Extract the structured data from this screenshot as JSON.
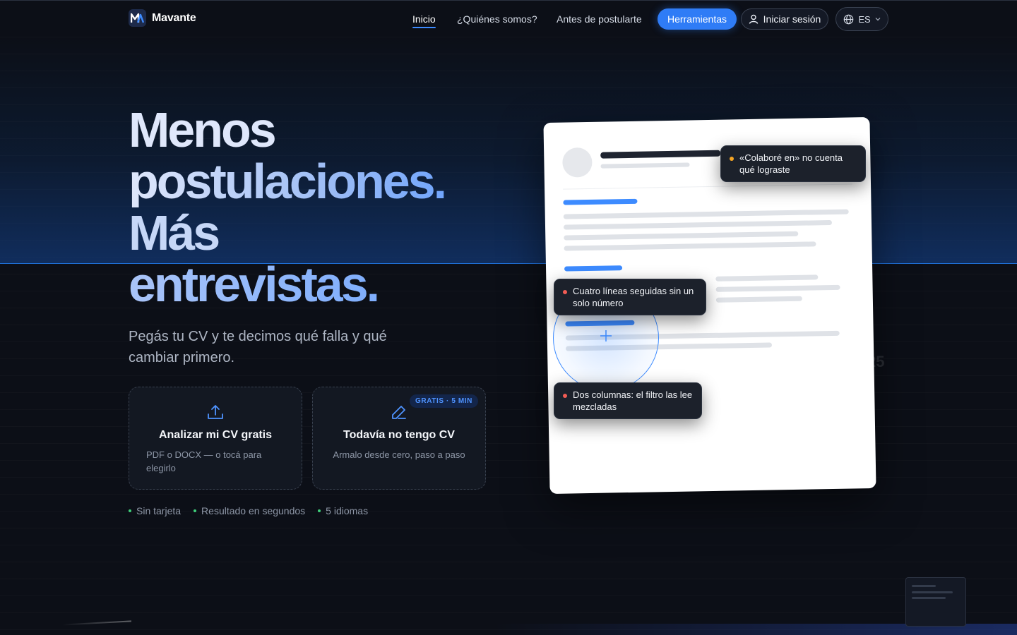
{
  "brand": {
    "name": "Mavante",
    "logo_text": "M"
  },
  "nav": {
    "links": [
      "Inicio",
      "¿Quiénes somos?",
      "Antes de postularte"
    ],
    "tools_button": "Herramientas",
    "login_button": "Iniciar sesión",
    "language": "ES"
  },
  "hero": {
    "title_lines": [
      "Menos",
      "postulaciones.",
      "Más",
      "entrevistas."
    ],
    "subtitle": "Pegás tu CV y te decimos qué falla y qué cambiar primero."
  },
  "actions": {
    "analyze": {
      "title": "Analizar mi CV gratis",
      "desc": "PDF o DOCX — o tocá para elegirlo",
      "icon": "upload-icon"
    },
    "create": {
      "title": "Todavía no tengo CV",
      "desc": "Armalo desde cero, paso a paso",
      "badge": "GRATIS · 5 MIN",
      "icon": "pencil-icon"
    }
  },
  "perks": [
    "Sin tarjeta",
    "Resultado en segundos",
    "5 idiomas"
  ],
  "cv_tips": [
    {
      "text": "«Colaboré en» no cuenta qué lograste",
      "color": "#f5a524"
    },
    {
      "text": "Cuatro líneas seguidas sin un solo número",
      "color": "#f25c54"
    },
    {
      "text": "Dos columnas: el filtro las lee mezcladas",
      "color": "#f25c54"
    }
  ],
  "background_text": "25",
  "colors": {
    "accent": "#2f7cf6",
    "background": "#0c0f17",
    "perk_dot": "#3ecf7a"
  }
}
